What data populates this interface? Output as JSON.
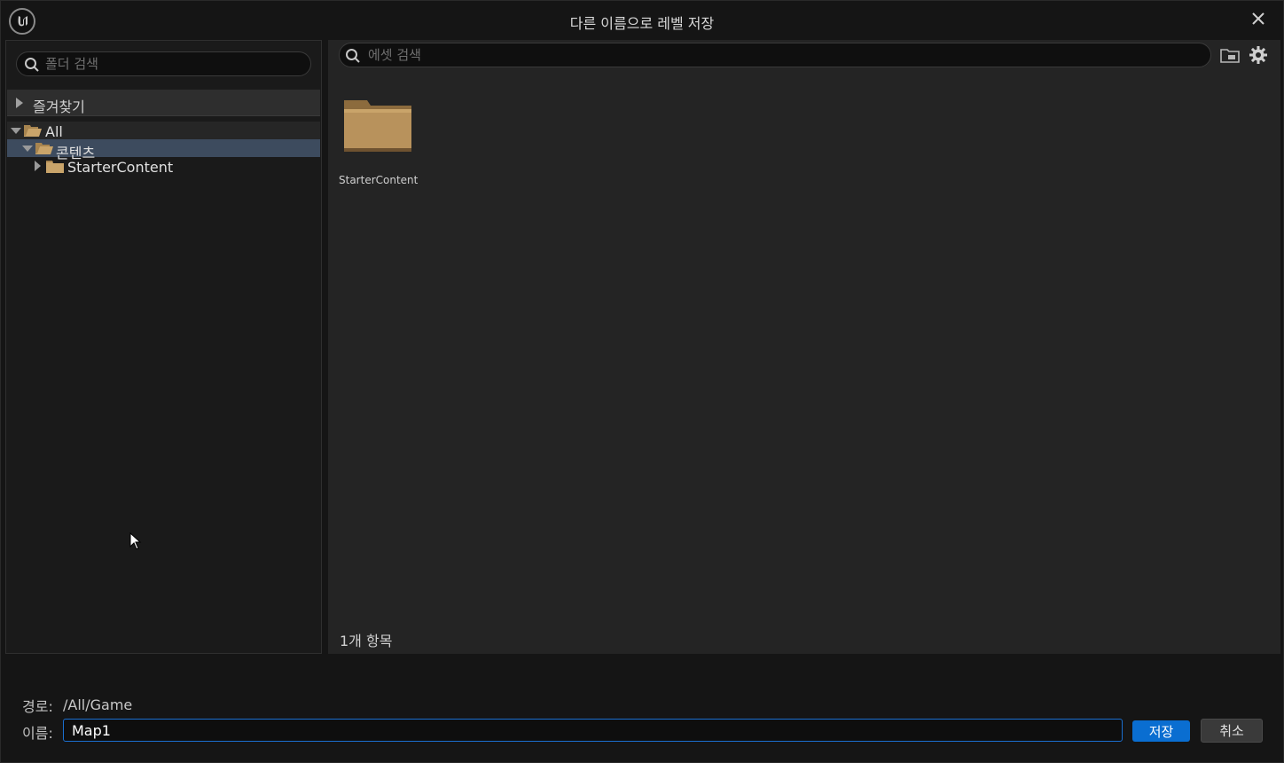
{
  "window": {
    "title": "다른 이름으로 레벨 저장"
  },
  "folder_panel": {
    "search_placeholder": "폴더 검색",
    "favorites_label": "즐겨찾기",
    "tree": [
      {
        "label": "All",
        "expanded": true
      },
      {
        "label": "콘텐츠",
        "expanded": true,
        "selected": true
      },
      {
        "label": "StarterContent",
        "expanded": false
      }
    ]
  },
  "asset_panel": {
    "search_placeholder": "에셋 검색",
    "assets": [
      {
        "label": "StarterContent",
        "type": "folder"
      }
    ],
    "item_count": "1개 항목"
  },
  "footer": {
    "path_label": "경로:",
    "path_value": "/All/Game",
    "name_label": "이름:",
    "name_value": "Map1",
    "save_label": "저장",
    "cancel_label": "취소"
  },
  "colors": {
    "accent": "#0a6ed1",
    "selection": "#3d4b5e",
    "folder": "#c9a46a"
  },
  "icons": [
    "unreal-logo-icon",
    "close-icon",
    "search-icon",
    "folder-icon",
    "folder-open-icon",
    "folder-add-icon",
    "gear-icon",
    "mouse-cursor-icon"
  ]
}
